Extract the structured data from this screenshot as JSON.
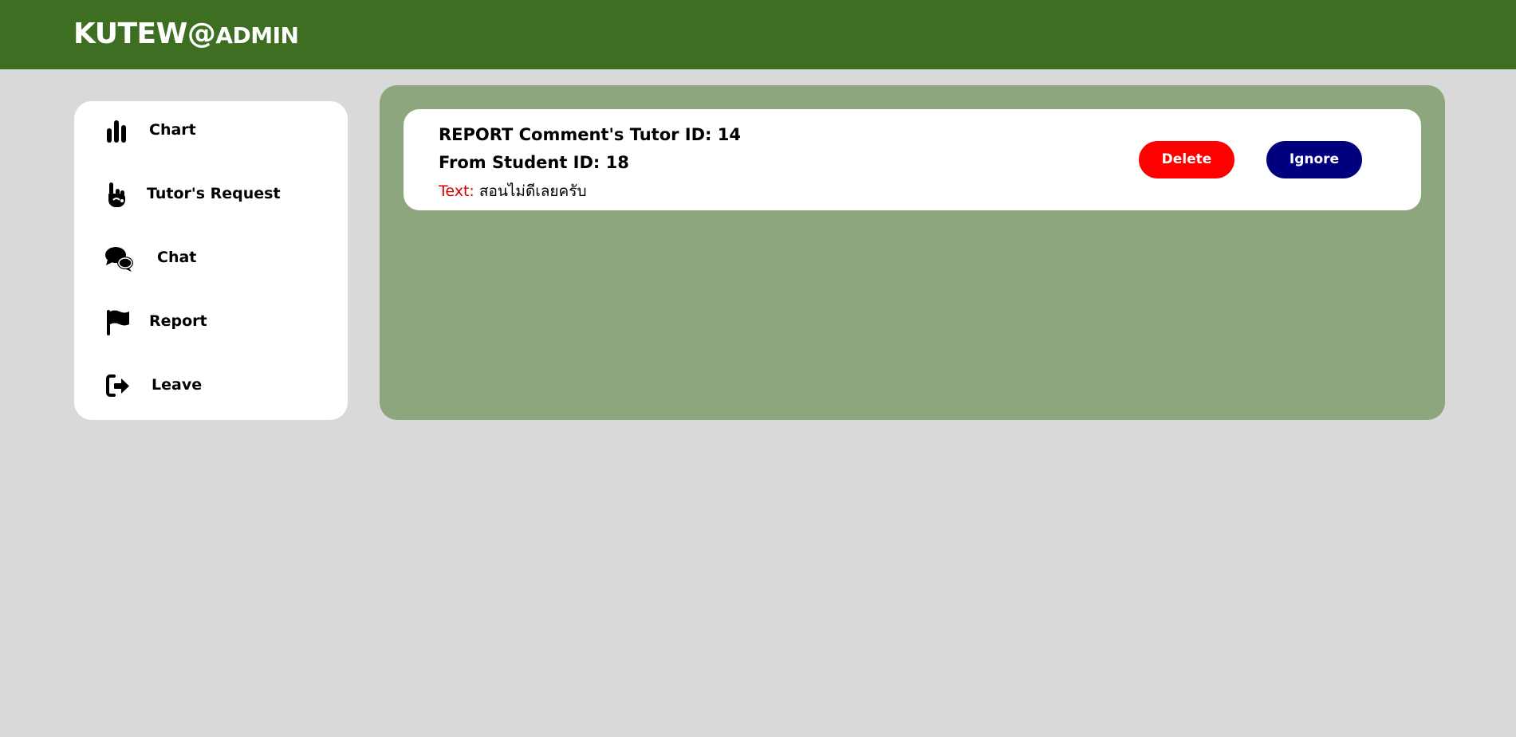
{
  "header": {
    "brand_main": "KUTEW@",
    "brand_sub": "ADMIN"
  },
  "sidebar": {
    "items": [
      {
        "label": "Chart",
        "icon": "bar-chart-icon"
      },
      {
        "label": "Tutor's Request",
        "icon": "hand-pointing-icon"
      },
      {
        "label": "Chat",
        "icon": "chat-bubbles-icon"
      },
      {
        "label": "Report",
        "icon": "flag-icon"
      },
      {
        "label": "Leave",
        "icon": "sign-out-icon"
      }
    ]
  },
  "report": {
    "title": "REPORT Comment's Tutor ID: 14",
    "from": "From Student ID: 18",
    "text_label": "Text:",
    "text_value": "สอนไม่ดีเลยครับ",
    "delete_label": "Delete",
    "ignore_label": "Ignore"
  },
  "colors": {
    "header_bg": "#3e6e21",
    "page_bg": "#d9d9d9",
    "panel_bg": "#8da67d",
    "delete_bg": "#ff0000",
    "ignore_bg": "#00007f",
    "text_label": "#d40000"
  }
}
